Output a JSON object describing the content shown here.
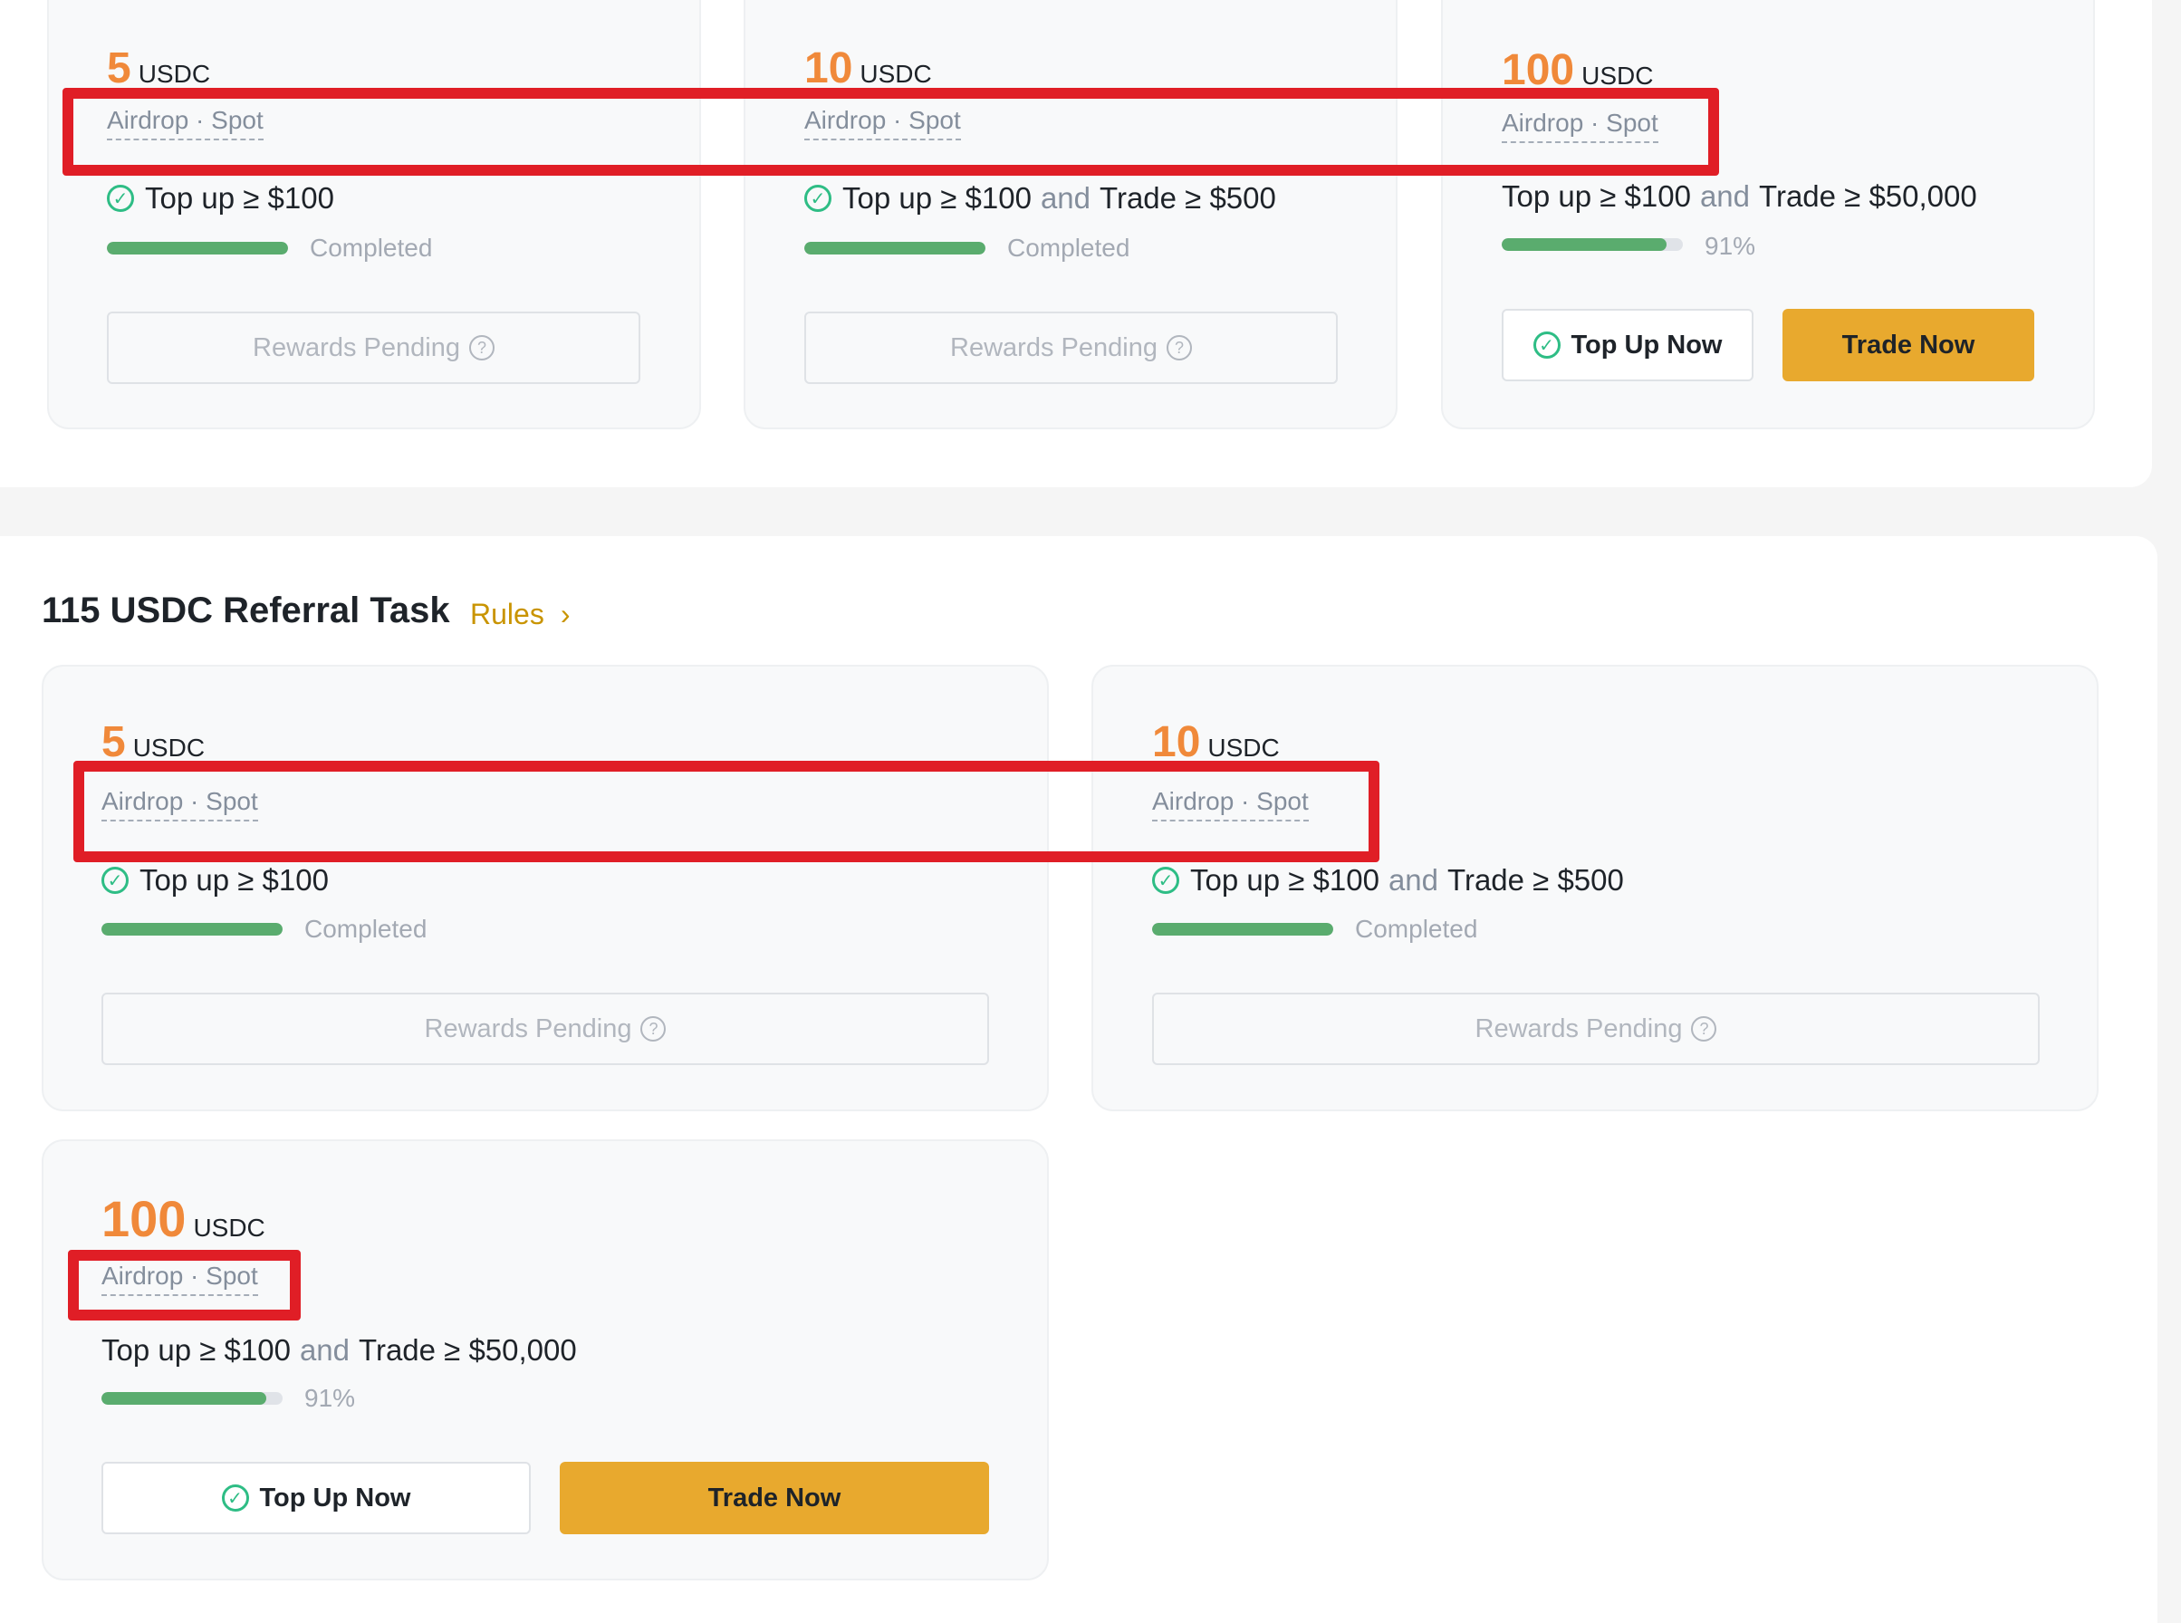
{
  "top_tasks": [
    {
      "amount": "5",
      "unit": "USDC",
      "tag": "Airdrop · Spot",
      "task": {
        "part1": "Top up ≥ $100",
        "and": "",
        "part2": ""
      },
      "completed": true,
      "progress": 1.0,
      "progress_text": "Completed",
      "button": "Rewards Pending"
    },
    {
      "amount": "10",
      "unit": "USDC",
      "tag": "Airdrop · Spot",
      "task": {
        "part1": "Top up ≥ $100",
        "and": "and",
        "part2": "Trade ≥ $500"
      },
      "completed": true,
      "progress": 1.0,
      "progress_text": "Completed",
      "button": "Rewards Pending"
    },
    {
      "amount": "100",
      "unit": "USDC",
      "tag": "Airdrop · Spot",
      "task": {
        "part1": "Top up ≥ $100",
        "and": "and",
        "part2": "Trade ≥ $50,000"
      },
      "completed": false,
      "progress": 0.91,
      "progress_text": "91%",
      "topup_label": "Top Up Now",
      "trade_label": "Trade Now"
    }
  ],
  "referral": {
    "title": "115 USDC Referral Task",
    "rules_label": "Rules",
    "tasks": [
      {
        "amount": "5",
        "unit": "USDC",
        "tag": "Airdrop · Spot",
        "task": {
          "part1": "Top up ≥ $100",
          "and": "",
          "part2": ""
        },
        "completed": true,
        "progress": 1.0,
        "progress_text": "Completed",
        "button": "Rewards Pending"
      },
      {
        "amount": "10",
        "unit": "USDC",
        "tag": "Airdrop · Spot",
        "task": {
          "part1": "Top up ≥ $100",
          "and": "and",
          "part2": "Trade ≥ $500"
        },
        "completed": true,
        "progress": 1.0,
        "progress_text": "Completed",
        "button": "Rewards Pending"
      },
      {
        "amount": "100",
        "unit": "USDC",
        "tag": "Airdrop · Spot",
        "task": {
          "part1": "Top up ≥ $100",
          "and": "and",
          "part2": "Trade ≥ $50,000"
        },
        "completed": false,
        "progress": 0.91,
        "progress_text": "91%",
        "topup_label": "Top Up Now",
        "trade_label": "Trade Now"
      }
    ]
  },
  "colors": {
    "accent_orange": "#f0893a",
    "highlight_red": "#e01e26",
    "button_yellow": "#e8a92e",
    "progress_green": "#5aac6e",
    "check_green": "#2ebd85"
  },
  "icons": {
    "check": "check-circle-icon",
    "question": "question-circle-icon",
    "chevron": "chevron-right-icon"
  }
}
